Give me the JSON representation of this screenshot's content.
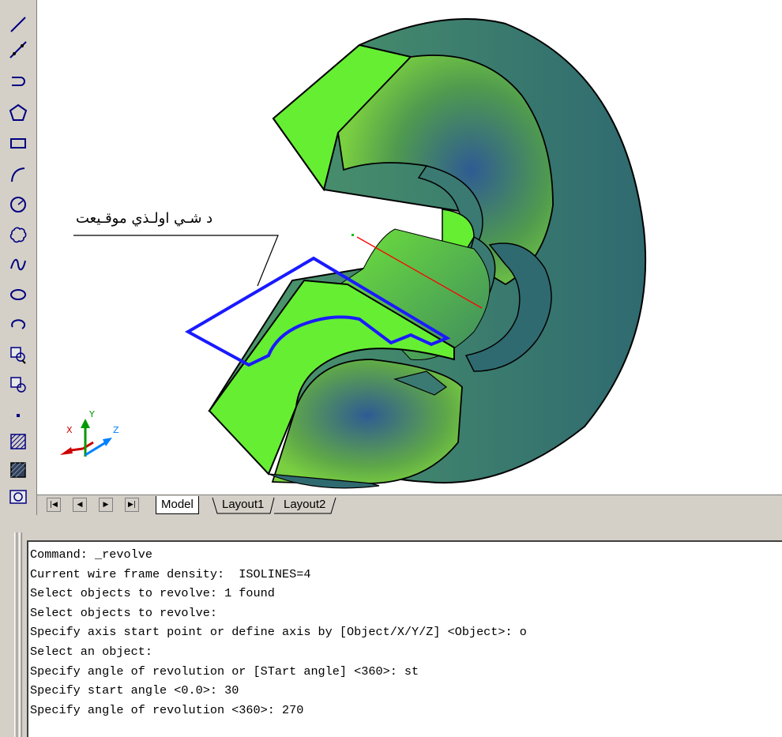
{
  "colors": {
    "face_green": "#66ee33",
    "shell_teal": "#3a7a72",
    "inner_blue": "#2f5b93",
    "profile_blue": "#1a1aff",
    "axis_red": "#ff0000",
    "ui_gray": "#d4d0c8"
  },
  "toolbar": {
    "icons": [
      "line-icon",
      "construction-line-icon",
      "polyline-icon",
      "polygon-icon",
      "rectangle-icon",
      "arc-icon",
      "circle-icon",
      "revision-cloud-icon",
      "spline-icon",
      "ellipse-icon",
      "ellipse-arc-icon",
      "insert-block-icon",
      "make-block-icon",
      "point-icon",
      "hatch-icon",
      "gradient-icon",
      "region-icon"
    ]
  },
  "drawing": {
    "annotation": "د شـي اولـذي موقـيعت",
    "ucs": {
      "x_label": "X",
      "y_label": "Y",
      "z_label": "Z"
    }
  },
  "layout_tabs": {
    "nav": [
      "|◀",
      "◀",
      "▶",
      "▶|"
    ],
    "tabs": [
      "Model",
      "Layout1",
      "Layout2"
    ]
  },
  "command_history": [
    "Command: _revolve",
    "Current wire frame density:  ISOLINES=4",
    "Select objects to revolve: 1 found",
    "Select objects to revolve:",
    "Specify axis start point or define axis by [Object/X/Y/Z] <Object>: o",
    "Select an object:",
    "Specify angle of revolution or [STart angle] <360>: st",
    "Specify start angle <0.0>: 30",
    "Specify angle of revolution <360>: 270"
  ]
}
